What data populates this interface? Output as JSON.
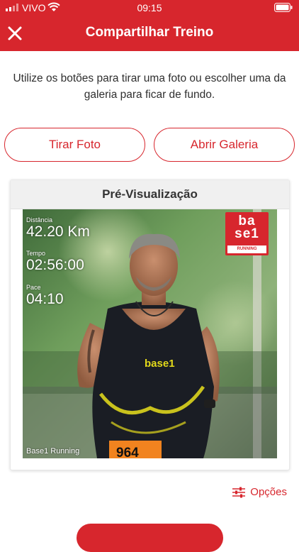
{
  "status_bar": {
    "carrier": "VIVO",
    "time": "09:15"
  },
  "header": {
    "title": "Compartilhar Treino"
  },
  "instructions": "Utilize os botões para tirar uma foto ou escolher uma da galeria para ficar de fundo.",
  "buttons": {
    "take_photo": "Tirar Foto",
    "open_gallery": "Abrir Galeria"
  },
  "preview": {
    "title": "Pré-Visualização",
    "stats": [
      {
        "label": "Distância",
        "value": "42.20 Km"
      },
      {
        "label": "Tempo",
        "value": "02:56:00"
      },
      {
        "label": "Pace",
        "value": "04:10"
      }
    ],
    "logo": {
      "line1": "ba",
      "line2": "se",
      "digit": "1",
      "sub": "RUNNING"
    },
    "shirt_text": "base1",
    "bib_number": "964",
    "caption": "Base1 Running"
  },
  "options_label": "Opções",
  "colors": {
    "brand_red": "#d7262d",
    "card_header": "#f0f0f0"
  },
  "icons": {
    "close": "close-icon",
    "options": "sliders-icon"
  }
}
